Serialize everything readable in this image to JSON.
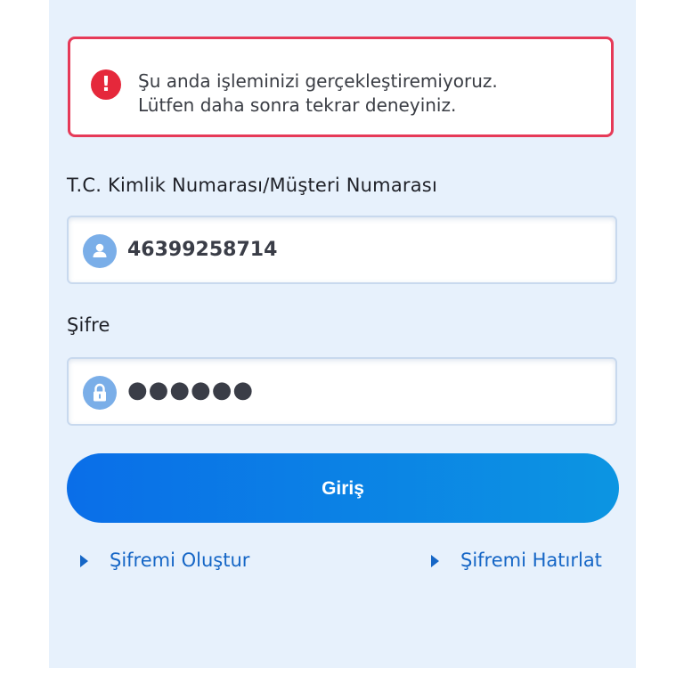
{
  "alert": {
    "icon": "error-exclamation-icon",
    "line1": "Şu anda işleminizi gerçekleştiremiyoruz.",
    "line2": "Lütfen daha sonra tekrar deneyiniz.",
    "icon_glyph": "!"
  },
  "form": {
    "id_label": "T.C. Kimlik Numarası/Müşteri Numarası",
    "id_value": "46399258714",
    "password_label": "Şifre",
    "password_value": "●●●●●●",
    "login_label": "Giriş"
  },
  "links": {
    "create_password": "Şifremi Oluştur",
    "remind_password": "Şifremi Hatırlat"
  },
  "colors": {
    "accent": "#0a6ee8",
    "alert_border": "#e63a58",
    "link": "#1566c6",
    "panel_bg": "#e7f1fc"
  }
}
